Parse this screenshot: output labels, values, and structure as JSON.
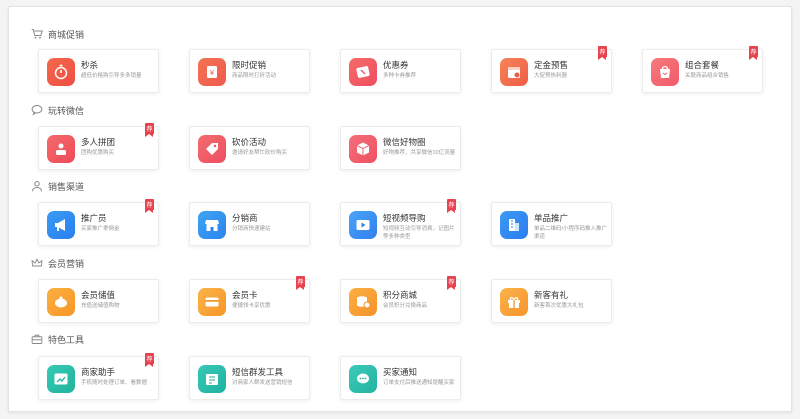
{
  "sections": [
    {
      "title": "商城促销",
      "icon": "cart-icon",
      "cards": [
        {
          "name": "秒杀",
          "desc": "超低价格购引导多多销量",
          "icon": "stopwatch-icon",
          "color": "#f4684a",
          "color2": "#f04d45",
          "badge": ""
        },
        {
          "name": "限时促销",
          "desc": "商品限时打折活动",
          "icon": "discount-tag-icon",
          "color": "#f27356",
          "color2": "#ef5a4b",
          "badge": ""
        },
        {
          "name": "优惠券",
          "desc": "多种卡券推荐",
          "icon": "coupon-icon",
          "color": "#f46c68",
          "color2": "#ef4e60",
          "badge": ""
        },
        {
          "name": "定金预售",
          "desc": "大促预热利器",
          "icon": "calendar-icon",
          "color": "#f6845a",
          "color2": "#ef5c45",
          "badge": "荐"
        },
        {
          "name": "组合套餐",
          "desc": "关联商品组合销售",
          "icon": "bag-icon",
          "color": "#f77b7b",
          "color2": "#f05a6a",
          "badge": "荐"
        }
      ]
    },
    {
      "title": "玩转微信",
      "icon": "chat-icon",
      "cards": [
        {
          "name": "多人拼团",
          "desc": "团购优惠购买",
          "icon": "group-user-icon",
          "color": "#f46a6a",
          "color2": "#ee4a5a",
          "badge": "荐"
        },
        {
          "name": "砍价活动",
          "desc": "邀请好友帮忙砍价购买",
          "icon": "bargain-tag-icon",
          "color": "#f26d6d",
          "color2": "#ee4e62",
          "badge": ""
        },
        {
          "name": "微信好物圈",
          "desc": "好物推荐，共享微信10亿流量",
          "icon": "cube-icon",
          "color": "#f2707a",
          "color2": "#ef5060",
          "badge": ""
        }
      ]
    },
    {
      "title": "销售渠道",
      "icon": "user-icon",
      "cards": [
        {
          "name": "推广员",
          "desc": "买家推广拿佣金",
          "icon": "megaphone-icon",
          "color": "#3a9bf4",
          "color2": "#2a7ff0",
          "badge": "荐"
        },
        {
          "name": "分销商",
          "desc": "分销商快速建站",
          "icon": "store-icon",
          "color": "#3ea4f2",
          "color2": "#2d84ee",
          "badge": ""
        },
        {
          "name": "短视频导购",
          "desc": "短视频互动引导消费，记图片等多种类型",
          "icon": "video-icon",
          "color": "#4aa4f6",
          "color2": "#3180ef",
          "badge": "荐"
        },
        {
          "name": "单品推广",
          "desc": "单品二维码/小程序码推入推广渠道",
          "icon": "building-icon",
          "color": "#3d9af5",
          "color2": "#2b7cf0",
          "badge": ""
        }
      ]
    },
    {
      "title": "会员营销",
      "icon": "crown-icon",
      "cards": [
        {
          "name": "会员储值",
          "desc": "充值送储值购物",
          "icon": "piggy-bank-icon",
          "color": "#fbb040",
          "color2": "#f79626",
          "badge": ""
        },
        {
          "name": "会员卡",
          "desc": "便捷领卡享优惠",
          "icon": "member-card-icon",
          "color": "#fbb347",
          "color2": "#f7962a",
          "badge": "荐"
        },
        {
          "name": "积分商城",
          "desc": "会员积分兑换商品",
          "icon": "coins-icon",
          "color": "#fab044",
          "color2": "#f6922a",
          "badge": "荐"
        },
        {
          "name": "新客有礼",
          "desc": "新客首次优惠大礼包",
          "icon": "gift-icon",
          "color": "#fbb24a",
          "color2": "#f7942c",
          "badge": ""
        }
      ]
    },
    {
      "title": "特色工具",
      "icon": "toolbox-icon",
      "cards": [
        {
          "name": "商家助手",
          "desc": "手机随时处理订单、看数据",
          "icon": "chart-board-icon",
          "color": "#36c9b4",
          "color2": "#20b49e",
          "badge": "荐"
        },
        {
          "name": "短信群发工具",
          "desc": "对商家人群发送营销短信",
          "icon": "sms-icon",
          "color": "#38c8b6",
          "color2": "#1fb2a0",
          "badge": ""
        },
        {
          "name": "买家通知",
          "desc": "订单支付后推送通知提醒买家",
          "icon": "message-bubble-icon",
          "color": "#3ccab7",
          "color2": "#22b4a1",
          "badge": ""
        }
      ]
    }
  ]
}
